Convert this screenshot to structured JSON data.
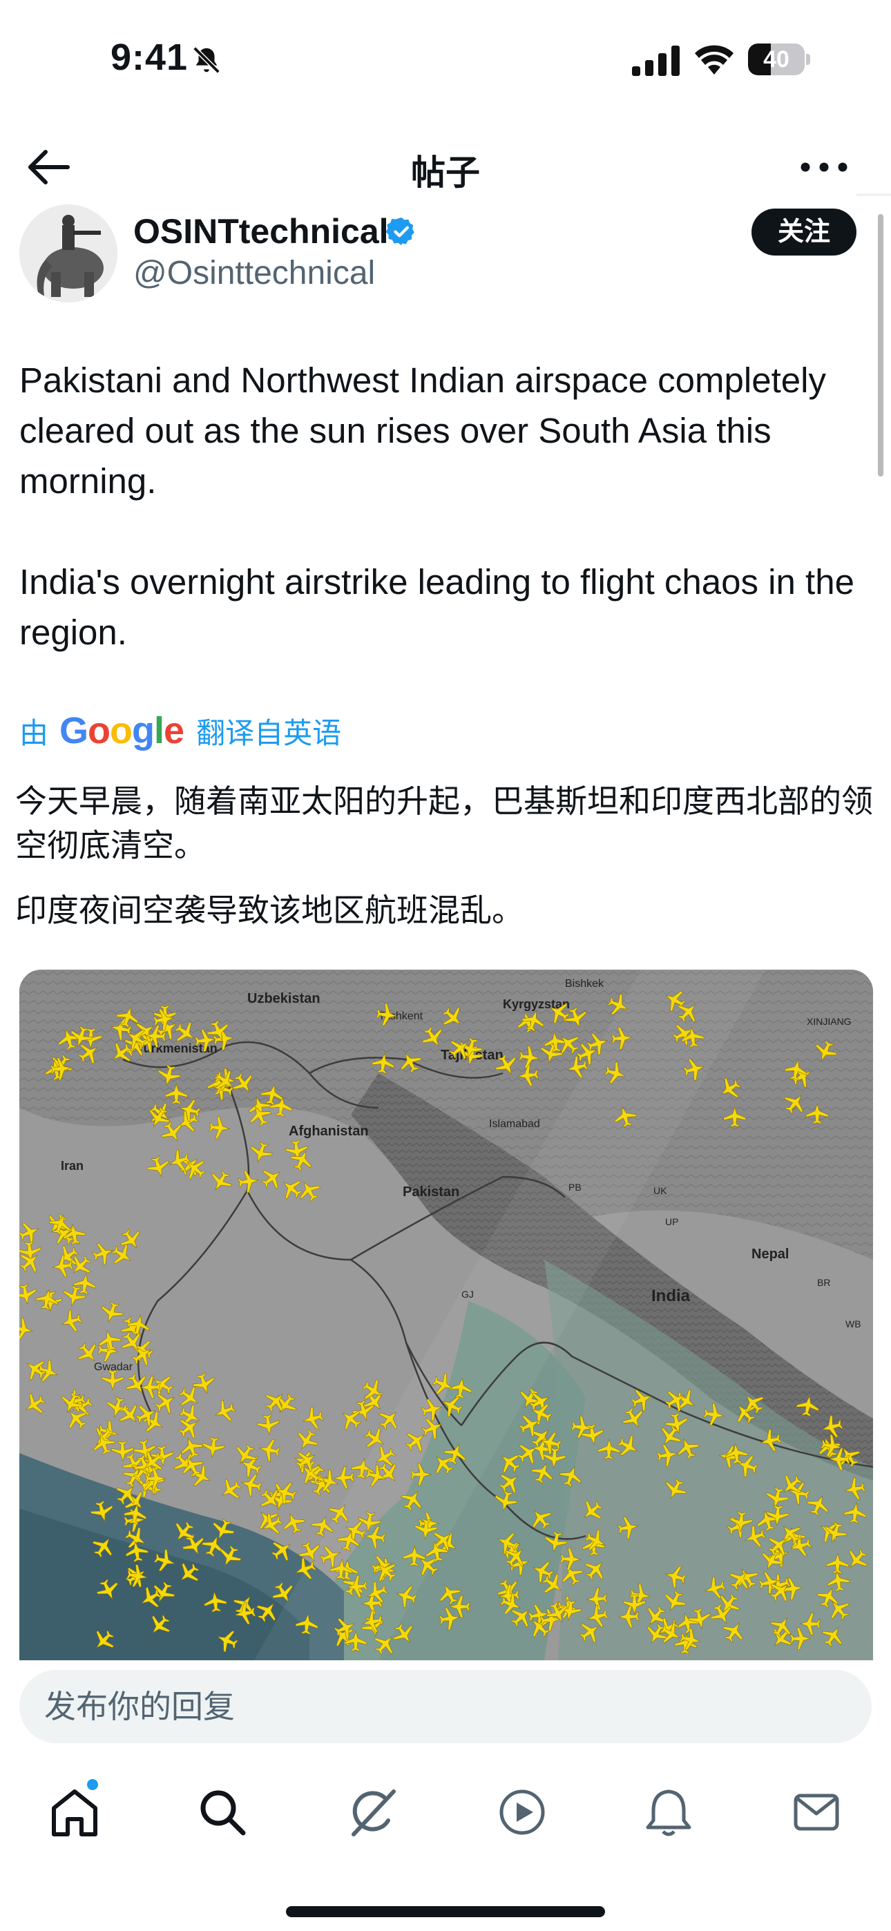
{
  "status_bar": {
    "time": "9:41",
    "battery": "40",
    "battery_level": 0.4,
    "icons": [
      "bell-slash-icon",
      "cellular-signal-icon",
      "wifi-icon",
      "battery-icon"
    ]
  },
  "header": {
    "title": "帖子",
    "back_icon": "arrow-left-icon",
    "more_icon": "more-horizontal-icon"
  },
  "author": {
    "name": "OSINTtechnical",
    "handle": "@Osinttechnical",
    "verified": true,
    "follow_label": "关注"
  },
  "tweet": {
    "paragraphs": [
      "Pakistani and Northwest Indian airspace completely cleared out as the sun rises over South Asia this morning.",
      "India's overnight airstrike leading to flight chaos in the region."
    ]
  },
  "translation": {
    "prefix": "由",
    "provider": "Google",
    "suffix": "翻译自英语",
    "paragraphs": [
      "今天早晨，随着南亚太阳的升起，巴基斯坦和印度西北部的领空彻底清空。",
      "印度夜间空袭导致该地区航班混乱。"
    ]
  },
  "map": {
    "labels": [
      "Uzbekistan",
      "Turkmenistan",
      "Tashkent",
      "Kyrgyzstan",
      "Bishkek",
      "Tajikistan",
      "XINJIANG",
      "Afghanistan",
      "Islamabad",
      "Iran",
      "Pakistan",
      "PB",
      "UK",
      "UP",
      "Nepal",
      "BR",
      "WB",
      "India",
      "GJ",
      "Gwadar"
    ],
    "plane_color": "#f5d90a"
  },
  "reply": {
    "placeholder": "发布你的回复"
  },
  "tab_bar": {
    "items": [
      "home-icon",
      "search-icon",
      "grok-icon",
      "video-icon",
      "notifications-icon",
      "messages-icon"
    ]
  },
  "colors": {
    "accent": "#1d9bf0",
    "text": "#0f1419",
    "secondary": "#536471"
  }
}
